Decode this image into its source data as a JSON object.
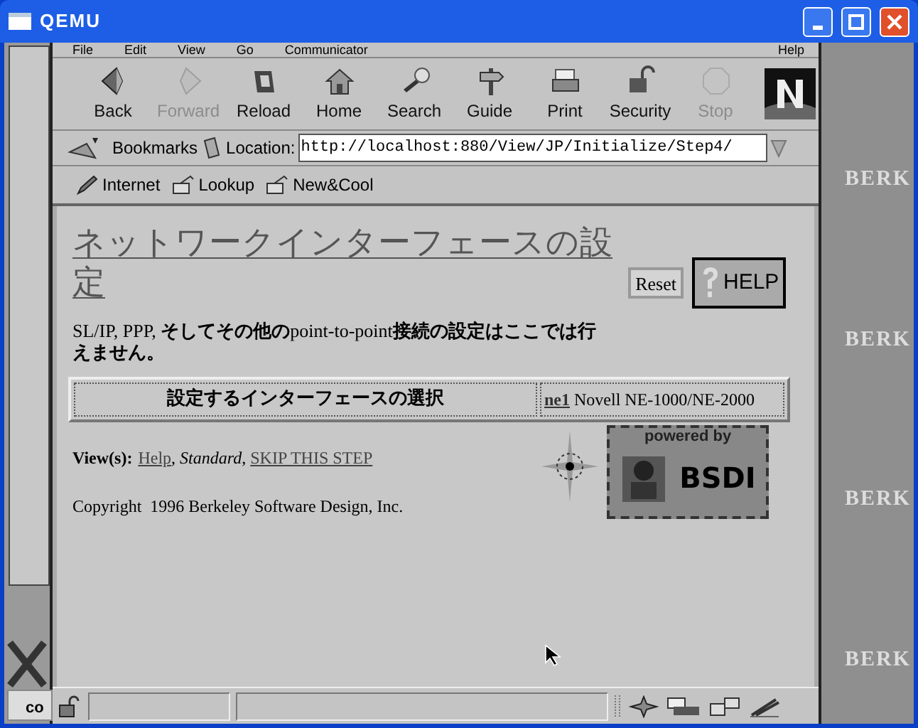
{
  "window": {
    "title": "QEMU"
  },
  "desktop": {
    "taskbar_label": "co",
    "wallpaper_labels": [
      "BERK",
      "BERK",
      "BERK",
      "BERK"
    ]
  },
  "browser": {
    "menu": [
      "File",
      "Edit",
      "View",
      "Go",
      "Communicator",
      "Help"
    ],
    "toolbar": [
      {
        "kind": "back",
        "label": "Back",
        "disabled": false
      },
      {
        "kind": "forward",
        "label": "Forward",
        "disabled": true
      },
      {
        "kind": "reload",
        "label": "Reload",
        "disabled": false
      },
      {
        "kind": "home",
        "label": "Home",
        "disabled": false
      },
      {
        "kind": "search",
        "label": "Search",
        "disabled": false
      },
      {
        "kind": "guide",
        "label": "Guide",
        "disabled": false
      },
      {
        "kind": "print",
        "label": "Print",
        "disabled": false
      },
      {
        "kind": "security",
        "label": "Security",
        "disabled": false
      },
      {
        "kind": "stop",
        "label": "Stop",
        "disabled": true
      }
    ],
    "location_bar": {
      "bookmarks": "Bookmarks",
      "label": "Location:",
      "url": "http://localhost:880/View/JP/Initialize/Step4/"
    },
    "personal_toolbar": [
      "Internet",
      "Lookup",
      "New&Cool"
    ],
    "page": {
      "heading": "ネットワークインターフェースの設定",
      "buttons": [
        "Reset",
        "HELP"
      ],
      "notice": "SL/IP, PPP, **そしてその他の**point-to-point**接続の設定はここでは行えません。**",
      "table": {
        "label": "設定するインターフェースの選択",
        "interface_link": "ne1",
        "interface_name": "Novell NE-1000/NE-2000"
      },
      "views": {
        "label": "View(s):",
        "separator": ",",
        "options": [
          {
            "label": "Help",
            "kind": "link"
          },
          {
            "label": "Standard",
            "kind": "current"
          },
          {
            "label": "SKIP THIS STEP",
            "kind": "link"
          }
        ]
      },
      "logo": {
        "caption": "powered by",
        "name": "BSDI"
      },
      "copyright": "Copyright  1996 Berkeley Software Design, Inc."
    }
  }
}
